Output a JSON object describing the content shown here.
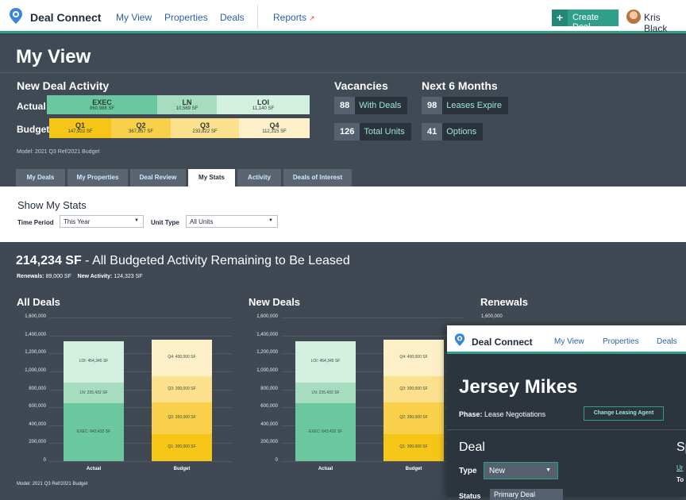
{
  "nav": {
    "brand": "Deal Connect",
    "links": [
      "My View",
      "Properties",
      "Deals",
      "Reports"
    ],
    "create_label": "Create Deal",
    "user_name": "Kris Black",
    "accent": "#2f9f8a"
  },
  "page": {
    "title": "My View"
  },
  "deal_activity": {
    "title": "New Deal Activity",
    "actual_label": "Actual",
    "budget_label": "Budget",
    "actual": [
      {
        "name": "EXEC",
        "sf": "860,988 SF",
        "color": "#6ac7a0"
      },
      {
        "name": "LN",
        "sf": "10,569 SF",
        "color": "#a6dcc0"
      },
      {
        "name": "LOI",
        "sf": "11,140 SF",
        "color": "#d3efe0"
      }
    ],
    "budget": [
      {
        "name": "Q1",
        "sf": "147,922 SF",
        "color": "#f5c518"
      },
      {
        "name": "Q2",
        "sf": "367,857 SF",
        "color": "#f8d04a"
      },
      {
        "name": "Q3",
        "sf": "233,822 SF",
        "color": "#fbe08d"
      },
      {
        "name": "Q4",
        "sf": "112,315 SF",
        "color": "#fdf0c8"
      }
    ],
    "model_note": "Model: 2021 Q3 Ref/2021 Budget"
  },
  "vacancies": {
    "title": "Vacancies",
    "items": [
      {
        "num": "88",
        "label": "With Deals"
      },
      {
        "num": "126",
        "label": "Total Units"
      }
    ]
  },
  "next6": {
    "title": "Next 6 Months",
    "items": [
      {
        "num": "98",
        "label": "Leases Expire"
      },
      {
        "num": "41",
        "label": "Options"
      }
    ]
  },
  "tabs": [
    "My Deals",
    "My Properties",
    "Deal Review",
    "My Stats",
    "Activity",
    "Deals of Interest"
  ],
  "active_tab": "My Stats",
  "filters": {
    "title": "Show My Stats",
    "time_label": "Time Period",
    "time_value": "This Year",
    "unit_label": "Unit Type",
    "unit_value": "All Units"
  },
  "summary": {
    "headline_value": "214,234 SF",
    "headline_text": " - All Budgeted Activity Remaining to Be Leased",
    "renewals_label": "Renewals:",
    "renewals_value": "89,000 SF",
    "new_label": "New Activity:",
    "new_value": "124,323 SF",
    "model_note": "Model: 2021 Q3 Ref/2021 Budget"
  },
  "chart_data": [
    {
      "type": "bar",
      "title": "All Deals",
      "categories": [
        "Actual",
        "Budget"
      ],
      "ylim": [
        0,
        1600000
      ],
      "yticks": [
        "1,600,000",
        "1,400,000",
        "1,200,000",
        "1,000,000",
        "800,000",
        "600,000",
        "400,000",
        "200,000",
        "0"
      ],
      "series": [
        {
          "name": "EXEC",
          "values": [
            643432,
            null
          ],
          "label": "EXEC: 643,432 SF",
          "color": "#6ac7a0"
        },
        {
          "name": "LN",
          "values": [
            235432,
            null
          ],
          "label": "LN: 235,432 SF",
          "color": "#a6dcc0"
        },
        {
          "name": "LOI",
          "values": [
            454345,
            null
          ],
          "label": "LOI: 454,345 SF",
          "color": "#d3efe0"
        },
        {
          "name": "Q1",
          "values": [
            null,
            300000
          ],
          "label": "Q1: 300,000 SF",
          "color": "#f5c518"
        },
        {
          "name": "Q2",
          "values": [
            null,
            350000
          ],
          "label": "Q2: 350,000 SF",
          "color": "#f8d04a"
        },
        {
          "name": "Q3",
          "values": [
            null,
            300000
          ],
          "label": "Q3: 300,000 SF",
          "color": "#fbe08d"
        },
        {
          "name": "Q4",
          "values": [
            null,
            400000
          ],
          "label": "Q4: 400,000 SF",
          "color": "#fdf0c8"
        }
      ]
    },
    {
      "type": "bar",
      "title": "New Deals",
      "categories": [
        "Actual",
        "Budget"
      ],
      "ylim": [
        0,
        1600000
      ],
      "yticks": [
        "1,600,000",
        "1,400,000",
        "1,200,000",
        "1,000,000",
        "800,000",
        "600,000",
        "400,000",
        "200,000",
        "0"
      ],
      "series": [
        {
          "name": "EXEC",
          "values": [
            643432,
            null
          ],
          "label": "EXEC: 643,432 SF",
          "color": "#6ac7a0"
        },
        {
          "name": "LN",
          "values": [
            235432,
            null
          ],
          "label": "LN: 235,432 SF",
          "color": "#a6dcc0"
        },
        {
          "name": "LOI",
          "values": [
            454345,
            null
          ],
          "label": "LOI: 454,345 SF",
          "color": "#d3efe0"
        },
        {
          "name": "Q1",
          "values": [
            null,
            300000
          ],
          "label": "Q1: 300,000 SF",
          "color": "#f5c518"
        },
        {
          "name": "Q2",
          "values": [
            null,
            350000
          ],
          "label": "Q2: 350,000 SF",
          "color": "#f8d04a"
        },
        {
          "name": "Q3",
          "values": [
            null,
            300000
          ],
          "label": "Q3: 300,000 SF",
          "color": "#fbe08d"
        },
        {
          "name": "Q4",
          "values": [
            null,
            400000
          ],
          "label": "Q4: 400,000 SF",
          "color": "#fdf0c8"
        }
      ]
    },
    {
      "type": "bar",
      "title": "Renewals",
      "ylim": [
        0,
        1600000
      ],
      "yticks": [
        "1,600,000"
      ]
    }
  ],
  "overlay": {
    "brand": "Deal Connect",
    "links": [
      "My View",
      "Properties",
      "Deals"
    ],
    "title": "Jersey Mikes",
    "phase_label": "Phase:",
    "phase_value": "Lease Negotiations",
    "change_agent": "Change Leasing Agent",
    "section": "Deal",
    "section_right": "Sp",
    "type_label": "Type",
    "type_value": "New",
    "status_label": "Status",
    "status_value": "Primary Deal",
    "right_link": "Ur",
    "right_label": "To"
  }
}
